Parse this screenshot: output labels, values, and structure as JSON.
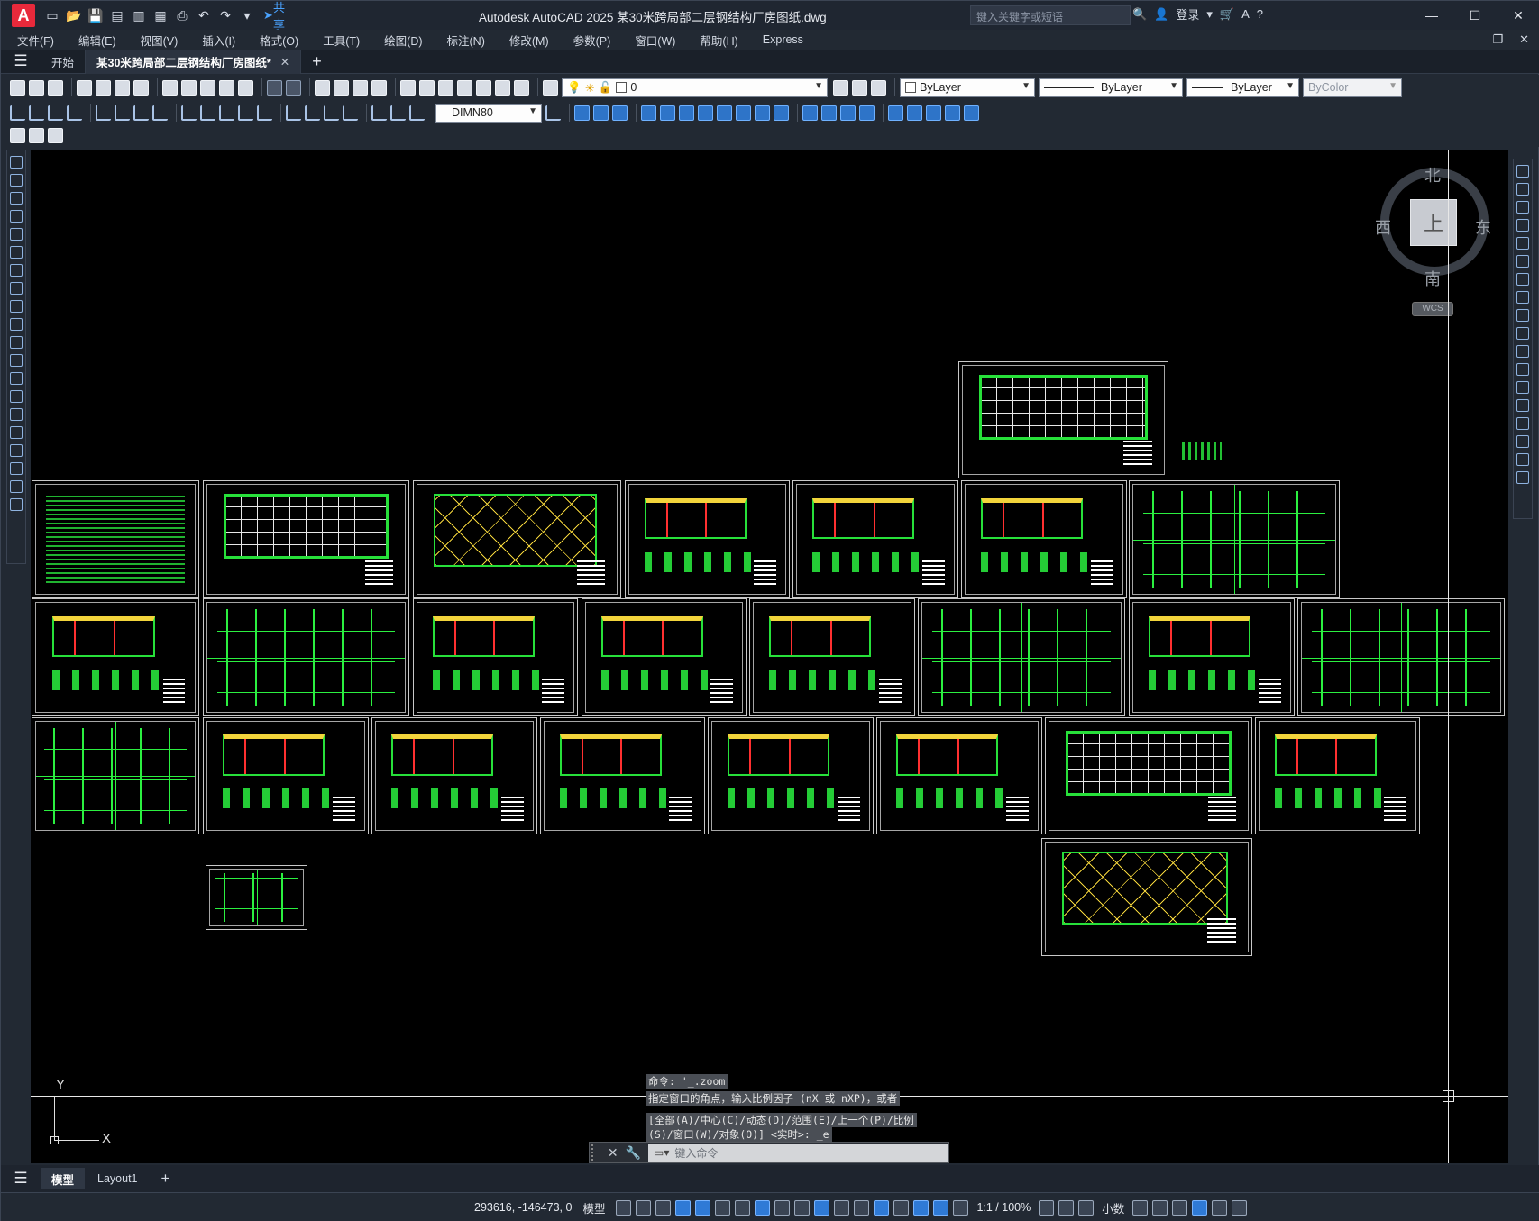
{
  "titlebar": {
    "app_logo": "A",
    "share_label": "共享",
    "title": "Autodesk AutoCAD 2025    某30米跨局部二层钢结构厂房图纸.dwg",
    "search_placeholder": "键入关键字或短语",
    "login_label": "登录"
  },
  "menu": [
    "文件(F)",
    "编辑(E)",
    "视图(V)",
    "插入(I)",
    "格式(O)",
    "工具(T)",
    "绘图(D)",
    "标注(N)",
    "修改(M)",
    "参数(P)",
    "窗口(W)",
    "帮助(H)",
    "Express"
  ],
  "tabs": {
    "start_label": "开始",
    "doc_label": "某30米跨局部二层钢结构厂房图纸*"
  },
  "properties": {
    "layer": "0",
    "color": "ByLayer",
    "linetype": "ByLayer",
    "lineweight": "ByLayer",
    "plotstyle": "ByColor",
    "dimstyle": "DIMN80"
  },
  "viewcube": {
    "north": "北",
    "south": "南",
    "east": "东",
    "west": "西",
    "face": "上",
    "wcs": "WCS"
  },
  "ucs": {
    "y_label": "Y",
    "x_label": "X"
  },
  "command": {
    "history": [
      "命令: '_.zoom",
      "指定窗口的角点，输入比例因子 (nX 或 nXP)，或者",
      "[全部(A)/中心(C)/动态(D)/范围(E)/上一个(P)/比例",
      "(S)/窗口(W)/对象(O)] <实时>: _e"
    ],
    "placeholder": "键入命令"
  },
  "layout_tabs": [
    "模型",
    "Layout1"
  ],
  "status": {
    "coords": "293616, -146473, 0",
    "model_label": "模型",
    "scale": "1:1 / 100%",
    "units": "小数"
  }
}
